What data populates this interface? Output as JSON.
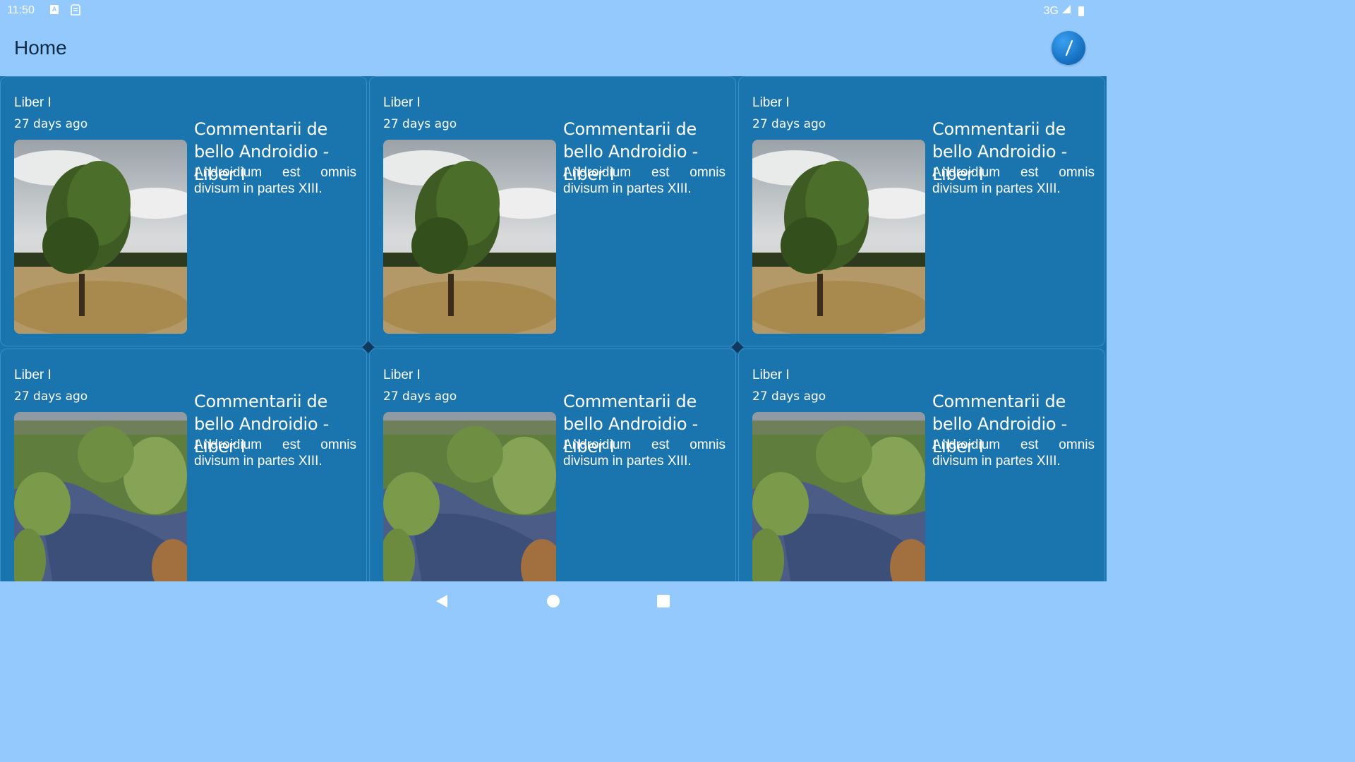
{
  "status_bar": {
    "time": "11:50",
    "notification_icon_letter": "A",
    "network": "3G"
  },
  "app_bar": {
    "title": "Home",
    "action_icon": "compass-icon"
  },
  "cards": [
    {
      "category": "Liber I",
      "time": "27 days ago",
      "title": "Commentarii de bello Androidio - Liber I",
      "description": "Androidium est omnis divisum in partes XIII.",
      "image": "tree"
    },
    {
      "category": "Liber I",
      "time": "27 days ago",
      "title": "Commentarii de bello Androidio - Liber I",
      "description": "Androidium est omnis divisum in partes XIII.",
      "image": "tree"
    },
    {
      "category": "Liber I",
      "time": "27 days ago",
      "title": "Commentarii de bello Androidio - Liber I",
      "description": "Androidium est omnis divisum in partes XIII.",
      "image": "tree"
    },
    {
      "category": "Liber I",
      "time": "27 days ago",
      "title": "Commentarii de bello Androidio - Liber I",
      "description": "Androidium est omnis divisum in partes XIII.",
      "image": "stream"
    },
    {
      "category": "Liber I",
      "time": "27 days ago",
      "title": "Commentarii de bello Androidio - Liber I",
      "description": "Androidium est omnis divisum in partes XIII.",
      "image": "stream"
    },
    {
      "category": "Liber I",
      "time": "27 days ago",
      "title": "Commentarii de bello Androidio - Liber I",
      "description": "Androidium est omnis divisum in partes XIII.",
      "image": "stream"
    }
  ],
  "nav_bar": {
    "back_icon": "back-triangle-icon",
    "home_icon": "home-circle-icon",
    "recents_icon": "recents-square-icon"
  },
  "colors": {
    "app_background": "#93c9fd",
    "card_background": "#1a74ad",
    "title_text": "#0f2b47",
    "card_text": "#ffffff"
  }
}
